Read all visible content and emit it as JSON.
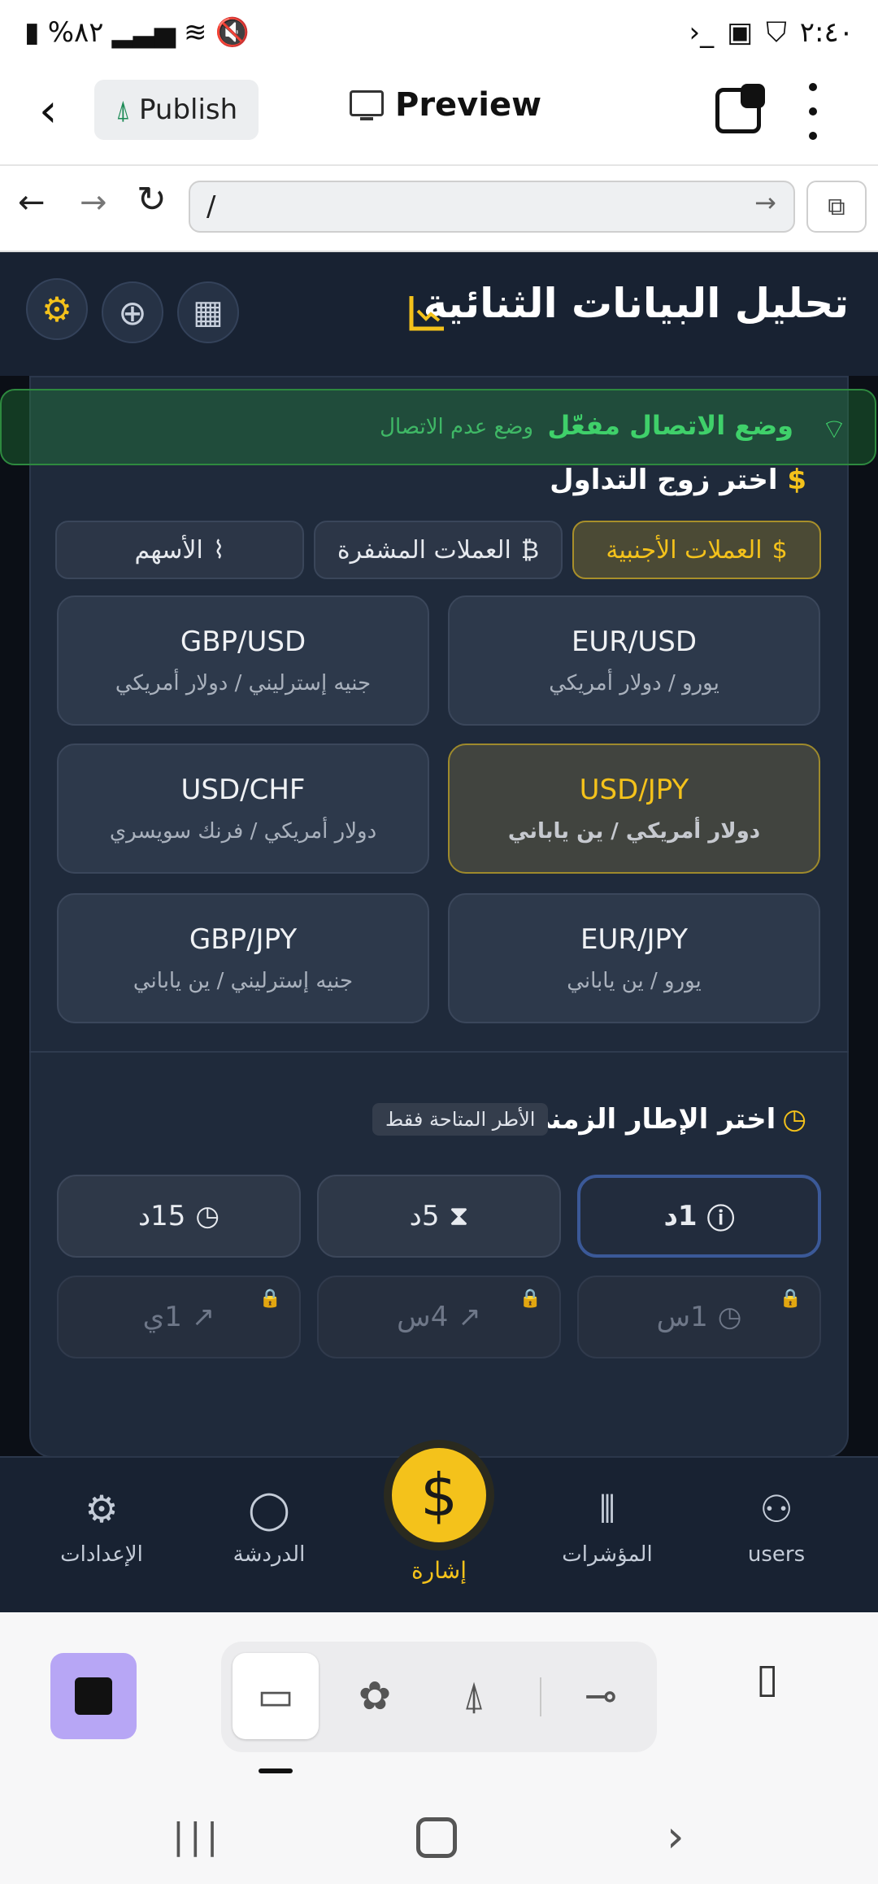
{
  "status_bar": {
    "time": "٢:٤٠",
    "battery": "%٨٢",
    "icons_left": [
      "battery-icon",
      "signal-icon",
      "wifi-icon",
      "mute-icon"
    ],
    "icons_right": [
      "terminal-icon",
      "image-icon",
      "shield-icon"
    ]
  },
  "app_bar": {
    "publish_label": "Publish",
    "preview_label": "Preview"
  },
  "url_bar": {
    "value": "/"
  },
  "app": {
    "title": "تحليل البيانات الثنائية",
    "connection": {
      "online": "وضع الاتصال مفعّل",
      "offline": "وضع عدم الاتصال"
    },
    "pair_section_title": "اختر زوج التداول",
    "categories": [
      {
        "label": "العملات الأجنبية",
        "icon": "$",
        "active": true
      },
      {
        "label": "العملات المشفرة",
        "icon": "₿",
        "active": false
      },
      {
        "label": "الأسهم",
        "icon": "⌇",
        "active": false
      }
    ],
    "pairs": [
      {
        "symbol": "EUR/USD",
        "name": "يورو / دولار أمريكي",
        "selected": false
      },
      {
        "symbol": "GBP/USD",
        "name": "جنيه إسترليني / دولار أمريكي",
        "selected": false
      },
      {
        "symbol": "USD/JPY",
        "name": "دولار أمريكي / ين ياباني",
        "selected": true
      },
      {
        "symbol": "USD/CHF",
        "name": "دولار أمريكي / فرنك سويسري",
        "selected": false
      },
      {
        "symbol": "EUR/JPY",
        "name": "يورو / ين ياباني",
        "selected": false
      },
      {
        "symbol": "GBP/JPY",
        "name": "جنيه إسترليني / ين ياباني",
        "selected": false
      }
    ],
    "timeframe_title": "اختر الإطار الزمني",
    "available_only": "الأطر المتاحة فقط",
    "timeframes": [
      {
        "label": "1د",
        "active": true,
        "locked": false
      },
      {
        "label": "5د",
        "active": false,
        "locked": false
      },
      {
        "label": "15د",
        "active": false,
        "locked": false
      },
      {
        "label": "1س",
        "active": false,
        "locked": true
      },
      {
        "label": "4س",
        "active": false,
        "locked": true
      },
      {
        "label": "1ي",
        "active": false,
        "locked": true
      }
    ],
    "bottom_nav": {
      "users": "users",
      "indicators": "المؤشرات",
      "signal": "إشارة",
      "chat": "الدردشة",
      "settings": "الإعدادات"
    }
  },
  "colors": {
    "accent": "#f4c21b",
    "online_green": "#3fd06a",
    "header_bg": "#182232",
    "panel_bg": "#1f2a3b"
  }
}
